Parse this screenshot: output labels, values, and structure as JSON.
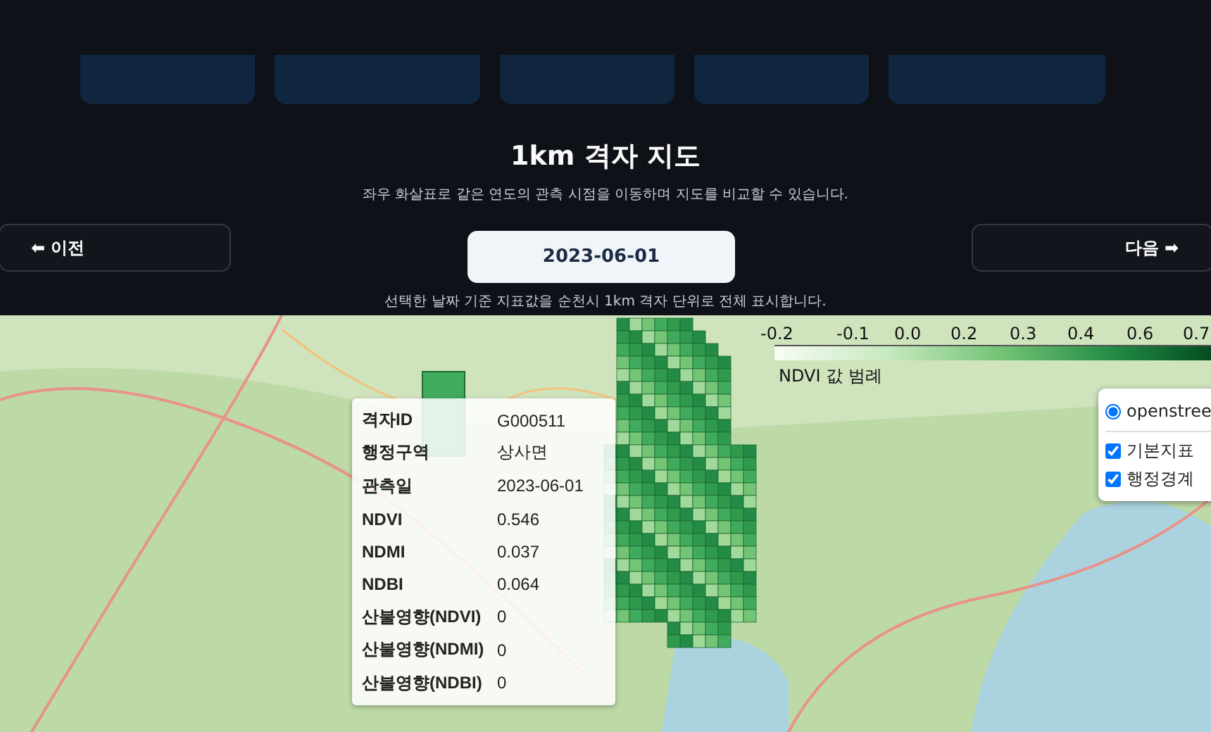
{
  "map_header": {
    "title": "1km 격자 지도",
    "subtitle": "좌우 화살표로 같은 연도의 관측 시점을 이동하며 지도를 비교할 수 있습니다.",
    "prev_button": "⬅ 이전",
    "next_button": "다음 ➡",
    "date": "2023-06-01",
    "caption": "선택한 날짜 기준 지표값을 순천시 1km 격자 단위로 전체 표시합니다."
  },
  "legend": {
    "ticks": [
      "-0.2",
      "-0.1",
      "0.0",
      "0.2",
      "0.3",
      "0.4",
      "0.6",
      "0.7"
    ],
    "title": "NDVI 값 범례"
  },
  "layer_control": {
    "base_layers": [
      {
        "label": "openstree",
        "selected": true
      }
    ],
    "overlays": [
      {
        "label": "기본지표",
        "checked": true
      },
      {
        "label": "행정경계",
        "checked": true
      }
    ]
  },
  "tooltip": {
    "rows": [
      {
        "label": "격자ID",
        "value": "G000511"
      },
      {
        "label": "행정구역",
        "value": "상사면"
      },
      {
        "label": "관측일",
        "value": "2023-06-01"
      },
      {
        "label": "NDVI",
        "value": "0.546"
      },
      {
        "label": "NDMI",
        "value": "0.037"
      },
      {
        "label": "NDBI",
        "value": "0.064"
      },
      {
        "label": "산불영향(NDVI)",
        "value": "0"
      },
      {
        "label": "산불영향(NDMI)",
        "value": "0"
      },
      {
        "label": "산불영향(NDBI)",
        "value": "0"
      }
    ]
  }
}
